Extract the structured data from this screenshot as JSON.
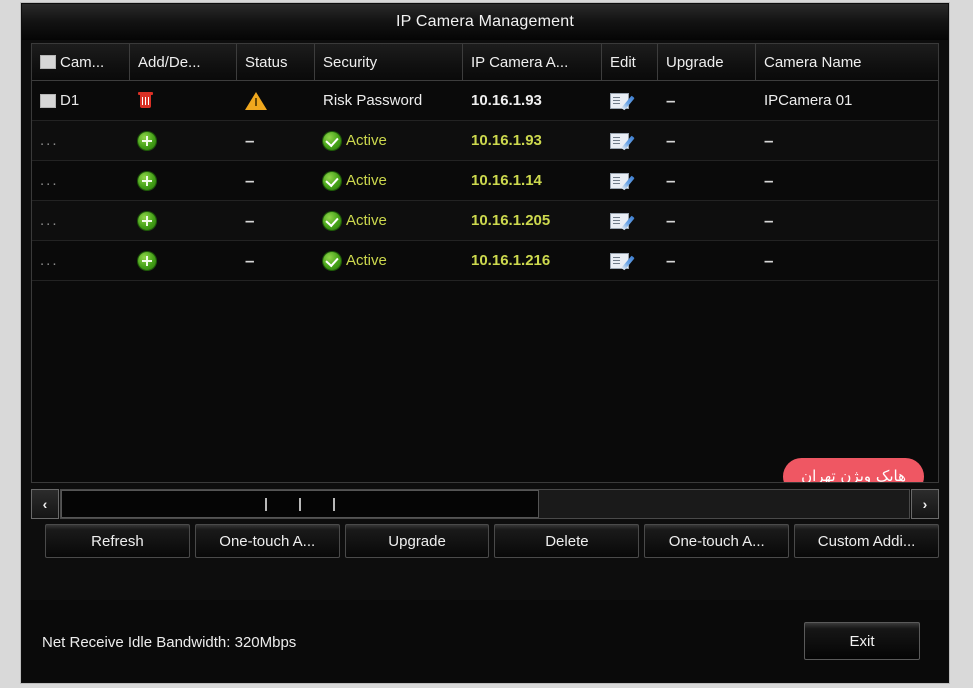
{
  "window": {
    "title": "IP Camera Management"
  },
  "table": {
    "columns": [
      {
        "key": "camera",
        "label": "Cam...",
        "has_checkbox": true
      },
      {
        "key": "add_delete",
        "label": "Add/De..."
      },
      {
        "key": "status",
        "label": "Status"
      },
      {
        "key": "security",
        "label": "Security"
      },
      {
        "key": "ip_address",
        "label": "IP Camera A..."
      },
      {
        "key": "edit",
        "label": "Edit"
      },
      {
        "key": "upgrade",
        "label": "Upgrade"
      },
      {
        "key": "camera_name",
        "label": "Camera Name"
      }
    ],
    "rows": [
      {
        "camera": "D1",
        "camera_checkbox": true,
        "add_delete_icon": "trash-icon",
        "status_icon": "warning-triangle-icon",
        "security": "Risk Password",
        "ip_address": "10.16.1.93",
        "ip_style": "white",
        "edit_icon": "edit-pencil-icon",
        "upgrade": "–",
        "camera_name": "IPCamera 01"
      },
      {
        "camera": "...",
        "camera_checkbox": false,
        "add_delete_icon": "plus-circle-icon",
        "status_icon": "dash",
        "status_text": "–",
        "security": "Active",
        "security_icon": "check-circle-icon",
        "ip_address": "10.16.1.93",
        "ip_style": "green",
        "edit_icon": "edit-pencil-icon",
        "upgrade": "–",
        "camera_name": "–"
      },
      {
        "camera": "...",
        "camera_checkbox": false,
        "add_delete_icon": "plus-circle-icon",
        "status_icon": "dash",
        "status_text": "–",
        "security": "Active",
        "security_icon": "check-circle-icon",
        "ip_address": "10.16.1.14",
        "ip_style": "green",
        "edit_icon": "edit-pencil-icon",
        "upgrade": "–",
        "camera_name": "–"
      },
      {
        "camera": "...",
        "camera_checkbox": false,
        "add_delete_icon": "plus-circle-icon",
        "status_icon": "dash",
        "status_text": "–",
        "security": "Active",
        "security_icon": "check-circle-icon",
        "ip_address": "10.16.1.205",
        "ip_style": "green",
        "edit_icon": "edit-pencil-icon",
        "upgrade": "–",
        "camera_name": "–"
      },
      {
        "camera": "...",
        "camera_checkbox": false,
        "add_delete_icon": "plus-circle-icon",
        "status_icon": "dash",
        "status_text": "–",
        "security": "Active",
        "security_icon": "check-circle-icon",
        "ip_address": "10.16.1.216",
        "ip_style": "green",
        "edit_icon": "edit-pencil-icon",
        "upgrade": "–",
        "camera_name": "–"
      }
    ]
  },
  "watermark": {
    "text": "هایک ویژن تهران",
    "background_color": "#ef5763",
    "text_color": "#ffffff"
  },
  "scrollbar": {
    "left_arrow": "‹",
    "right_arrow": "›"
  },
  "buttons": [
    {
      "key": "refresh",
      "label": "Refresh"
    },
    {
      "key": "one_touch_activate",
      "label": "One-touch A..."
    },
    {
      "key": "upgrade",
      "label": "Upgrade"
    },
    {
      "key": "delete",
      "label": "Delete"
    },
    {
      "key": "one_touch_adding",
      "label": "One-touch A..."
    },
    {
      "key": "custom_adding",
      "label": "Custom Addi..."
    }
  ],
  "footer": {
    "status_text": "Net Receive Idle Bandwidth: 320Mbps",
    "exit_label": "Exit"
  },
  "colors": {
    "accent_green": "#cdd94e",
    "danger_red": "#d93025",
    "warning_orange": "#f0a81e",
    "badge_red": "#ef5763"
  }
}
